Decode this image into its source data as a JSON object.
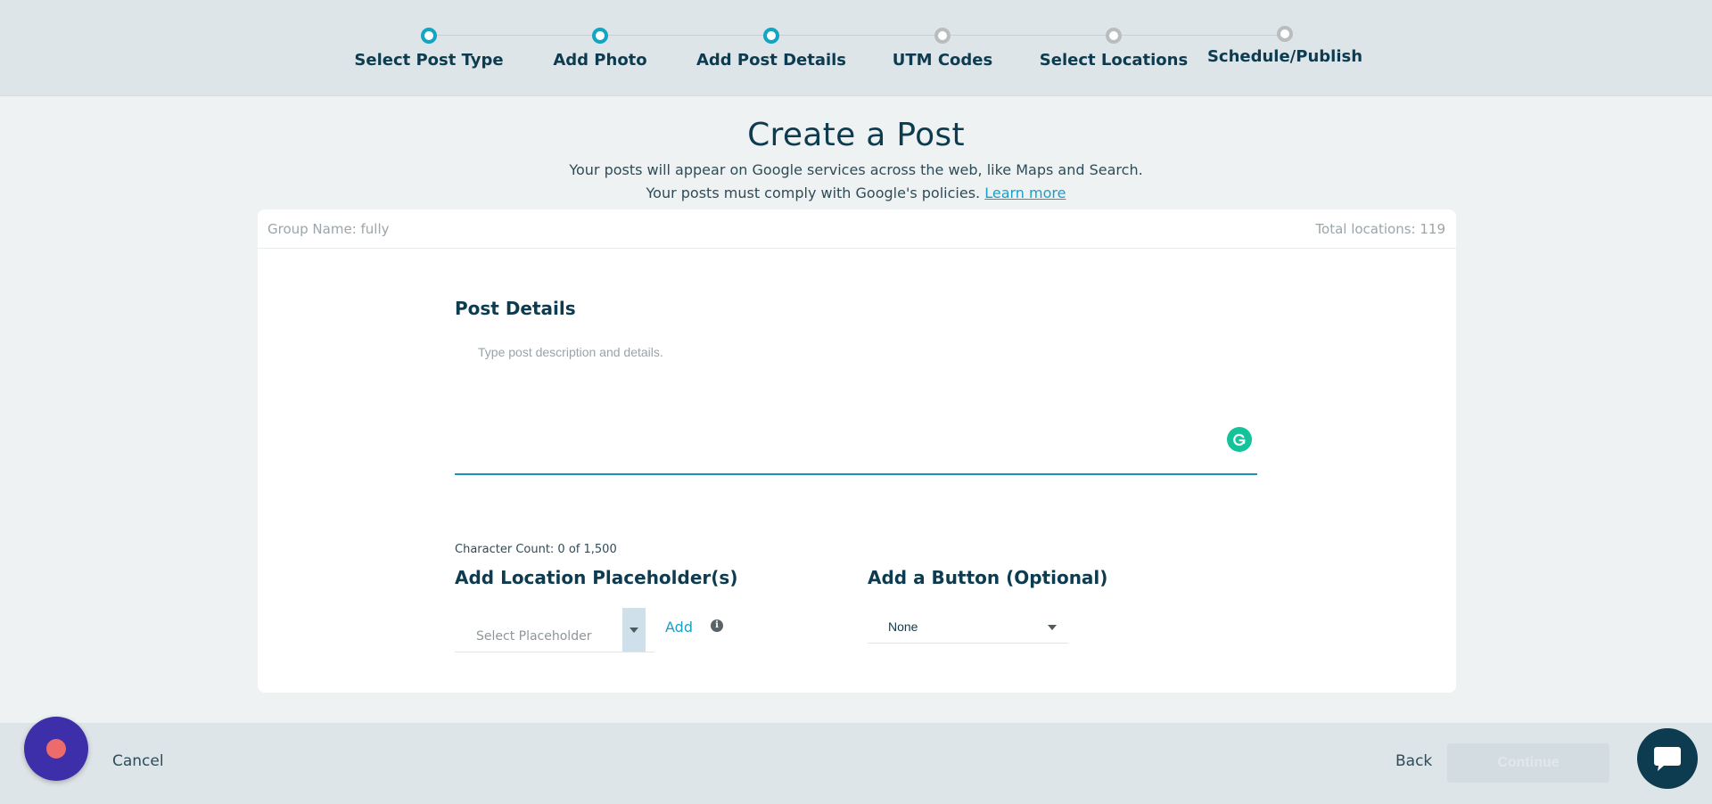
{
  "stepper": {
    "steps": [
      {
        "label": "Select Post Type",
        "status": "complete"
      },
      {
        "label": "Add Photo",
        "status": "complete"
      },
      {
        "label": "Add Post Details",
        "status": "current"
      },
      {
        "label": "UTM Codes",
        "status": "pending"
      },
      {
        "label": "Select Locations",
        "status": "pending"
      },
      {
        "label": "Schedule/Publish",
        "status": "pending"
      }
    ]
  },
  "header": {
    "title": "Create a Post",
    "subtitle_1": "Your posts will appear on Google services across the web, like Maps and Search.",
    "subtitle_2": "Your posts must comply with Google's policies.",
    "learn_more": "Learn more"
  },
  "card": {
    "group_name": "Group Name: fully",
    "total_locations": "Total locations: 119",
    "post_details_title": "Post Details",
    "description_placeholder": "Type post description and details.",
    "description_value": "",
    "character_count": "Character Count: 0 of 1,500",
    "placeholder_section_title": "Add Location Placeholder(s)",
    "placeholder_select_label": "Select Placeholder",
    "add_label": "Add",
    "button_section_title": "Add a Button (Optional)",
    "button_select_value": "None"
  },
  "footer": {
    "cancel_label": "Cancel",
    "back_label": "Back",
    "continue_label": "Continue"
  },
  "colors": {
    "accent": "#12a6c4",
    "primary_text": "#0d3b4f",
    "grammarly": "#15c39a",
    "record_button": "#3d2fa9"
  },
  "icons": [
    "grammarly-icon",
    "chevron-down-icon",
    "info-icon",
    "record-icon",
    "chat-icon"
  ]
}
